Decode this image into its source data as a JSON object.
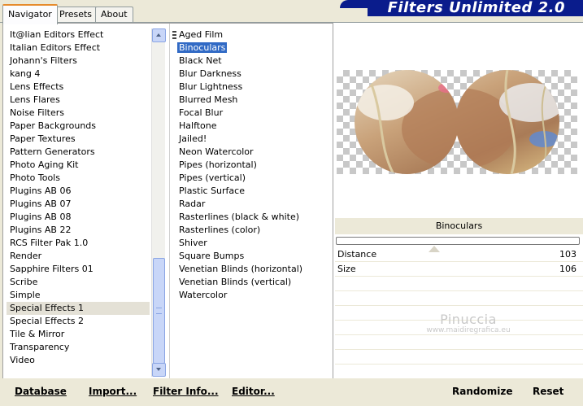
{
  "tabs": [
    "Navigator",
    "Presets",
    "About"
  ],
  "app_title": "Filters Unlimited 2.0",
  "categories": [
    "It@lian Editors Effect",
    "Italian Editors Effect",
    "Johann's Filters",
    "kang 4",
    "Lens Effects",
    "Lens Flares",
    "Noise Filters",
    "Paper Backgrounds",
    "Paper Textures",
    "Pattern Generators",
    "Photo Aging Kit",
    "Photo Tools",
    "Plugins AB 06",
    "Plugins AB 07",
    "Plugins AB 08",
    "Plugins AB 22",
    "RCS Filter Pak 1.0",
    "Render",
    "Sapphire Filters 01",
    "Scribe",
    "Simple",
    "Special Effects 1",
    "Special Effects 2",
    "Tile & Mirror",
    "Transparency",
    "Video"
  ],
  "selected_category": "Special Effects 1",
  "filters": [
    "Aged Film",
    "Binoculars",
    "Black Net",
    "Blur Darkness",
    "Blur Lightness",
    "Blurred Mesh",
    "Focal Blur",
    "Halftone",
    "Jailed!",
    "Neon Watercolor",
    "Pipes (horizontal)",
    "Pipes (vertical)",
    "Plastic Surface",
    "Radar",
    "Rasterlines (black & white)",
    "Rasterlines (color)",
    "Shiver",
    "Square Bumps",
    "Venetian Blinds (horizontal)",
    "Venetian Blinds (vertical)",
    "Watercolor"
  ],
  "selected_filter": "Binoculars",
  "current_filter_label": "Binoculars",
  "params": [
    {
      "label": "Distance",
      "value": "103"
    },
    {
      "label": "Size",
      "value": "106"
    }
  ],
  "watermark": {
    "line1": "Pinuccia",
    "line2": "www.maidiregrafica.eu"
  },
  "buttons": {
    "database": "Database",
    "import": "Import...",
    "filter_info": "Filter Info...",
    "editor": "Editor...",
    "randomize": "Randomize",
    "reset": "Reset"
  },
  "colors": {
    "selection": "#316ac5",
    "banner": "#0a1c8c"
  }
}
